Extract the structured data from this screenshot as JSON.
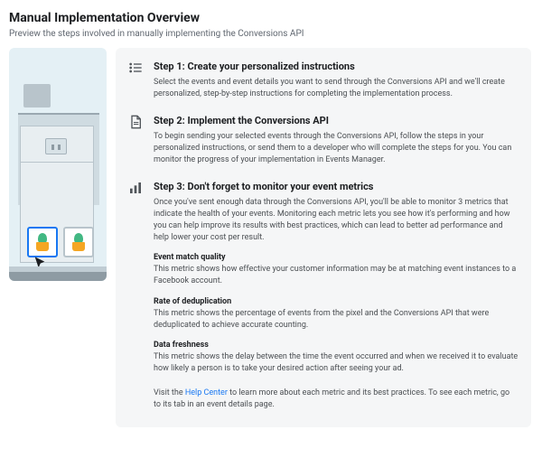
{
  "header": {
    "title": "Manual Implementation Overview",
    "subtitle": "Preview the steps involved in manually implementing the Conversions API"
  },
  "steps": [
    {
      "title": "Step 1: Create your personalized instructions",
      "desc": "Select the events and event details you want to send through the Conversions API and we'll create personalized, step-by-step instructions for completing the implementation process."
    },
    {
      "title": "Step 2: Implement the Conversions API",
      "desc": "To begin sending your selected events through the Conversions API, follow the steps in your personalized instructions, or send them to a developer who will complete the steps for you. You can monitor the progress of your implementation in Events Manager."
    },
    {
      "title": "Step 3: Don't forget to monitor your event metrics",
      "desc": "Once you've sent enough data through the Conversions API, you'll be able to monitor 3 metrics that indicate the health of your events. Monitoring each metric lets you see how it's performing and how you can help improve its results with best practices, which can lead to better ad performance and help lower your cost per result."
    }
  ],
  "metrics": [
    {
      "title": "Event match quality",
      "desc": "This metric shows how effective your customer information may be at matching event instances to a Facebook account."
    },
    {
      "title": "Rate of deduplication",
      "desc": "This metric shows the percentage of events from the pixel and the Conversions API that were deduplicated to achieve accurate counting."
    },
    {
      "title": "Data freshness",
      "desc": "This metric shows the delay between the time the event occurred and when we received it to evaluate how likely a person is to take your desired action after seeing your ad."
    }
  ],
  "footer": {
    "prefix": "Visit the ",
    "link_text": "Help Center",
    "suffix": " to learn more about each metric and its best practices. To see each metric, go to its tab in an event details page."
  }
}
